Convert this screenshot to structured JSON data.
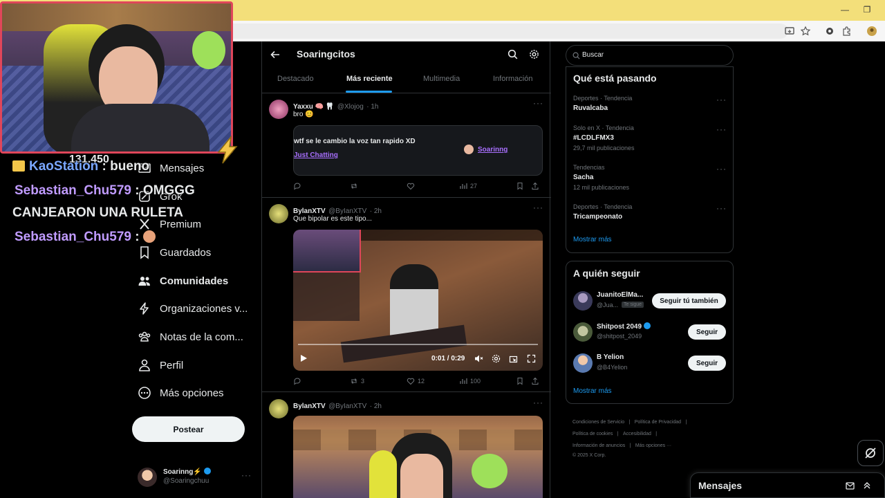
{
  "browser": {
    "window_minimize": "—",
    "window_restore": "❐"
  },
  "stream_overlay": {
    "viewer_count": "131.450",
    "chat": [
      {
        "user": "KaoStation",
        "sep": " : ",
        "message": "bueno",
        "color": "#7aa7ff"
      },
      {
        "user": "Sebastian_Chu579",
        "sep": " : ",
        "message": "OMGGG",
        "color": "#c09bff"
      },
      {
        "user": "",
        "sep": "",
        "message": "CANJEARON UNA RULETA",
        "color": "#ffffff"
      },
      {
        "user": "Sebastian_Chu579",
        "sep": " : ",
        "message": "",
        "color": "#c09bff"
      }
    ]
  },
  "sidebar": {
    "items": [
      {
        "label": "Mensajes",
        "icon": "envelope-icon"
      },
      {
        "label": "Grok",
        "icon": "grok-icon"
      },
      {
        "label": "Premium",
        "icon": "x-logo-icon"
      },
      {
        "label": "Guardados",
        "icon": "bookmark-icon"
      },
      {
        "label": "Comunidades",
        "icon": "people-icon"
      },
      {
        "label": "Organizaciones v...",
        "icon": "lightning-icon"
      },
      {
        "label": "Notas de la com...",
        "icon": "community-notes-icon"
      },
      {
        "label": "Perfil",
        "icon": "person-icon"
      },
      {
        "label": "Más opciones",
        "icon": "more-circle-icon"
      }
    ],
    "post_button": "Postear",
    "account": {
      "name": "Soarinng⚡",
      "handle": "@Soaringchuu"
    }
  },
  "community": {
    "title": "Soaringcitos",
    "tabs": [
      "Destacado",
      "Más reciente",
      "Multimedia",
      "Información"
    ],
    "active_tab": 1
  },
  "tweets": [
    {
      "name": "Yaxxu 🧠 🦷",
      "handle": "@Xlojog",
      "time": "· 1h",
      "text": "bro 😊",
      "card": {
        "title": "wtf se le cambio la voz tan rapido XD",
        "category": "Just Chatting",
        "channel": "Soarinng"
      },
      "replies": "",
      "retweets": "",
      "likes": "",
      "views": "27"
    },
    {
      "name": "BylanXTV",
      "handle": "@ByIanXTV",
      "time": "· 2h",
      "text": "Que bipolar es este tipo...",
      "video": {
        "time": "0:01 / 0:29"
      },
      "replies": "",
      "retweets": "3",
      "likes": "12",
      "views": "100"
    },
    {
      "name": "BylanXTV",
      "handle": "@ByIanXTV",
      "time": "· 2h",
      "text": ""
    }
  ],
  "right": {
    "search_placeholder": "Buscar",
    "trends_title": "Qué está pasando",
    "trends": [
      {
        "meta": "Deportes · Tendencia",
        "name": "Ruvalcaba",
        "count": ""
      },
      {
        "meta": "Solo en X · Tendencia",
        "name": "#LCDLFMX3",
        "count": "29,7 mil publicaciones"
      },
      {
        "meta": "Tendencias",
        "name": "Sacha",
        "count": "12 mil publicaciones"
      },
      {
        "meta": "Deportes · Tendencia",
        "name": "Tricampeonato",
        "count": ""
      }
    ],
    "show_more": "Mostrar más",
    "follow_title": "A quién seguir",
    "follow": [
      {
        "name": "JuanitoElMa...",
        "handle": "@Jua...",
        "badge": "Te sigue",
        "button": "Seguir tú también",
        "verified": false
      },
      {
        "name": "Shitpost 2049",
        "handle": "@shitpost_2049",
        "badge": "",
        "button": "Seguir",
        "verified": true
      },
      {
        "name": "B Yelion",
        "handle": "@B4Yelion",
        "badge": "",
        "button": "Seguir",
        "verified": false
      }
    ],
    "footer": [
      "Condiciones de Servicio",
      "Política de Privacidad",
      "Política de cookies",
      "Accesibilidad",
      "Información de anuncios",
      "Más opciones ···",
      "© 2025 X Corp."
    ],
    "messages_drawer": "Mensajes"
  },
  "colors": {
    "accent": "#1d9bf0",
    "cam_border": "#e0465a",
    "purple_link": "#a970ff"
  }
}
